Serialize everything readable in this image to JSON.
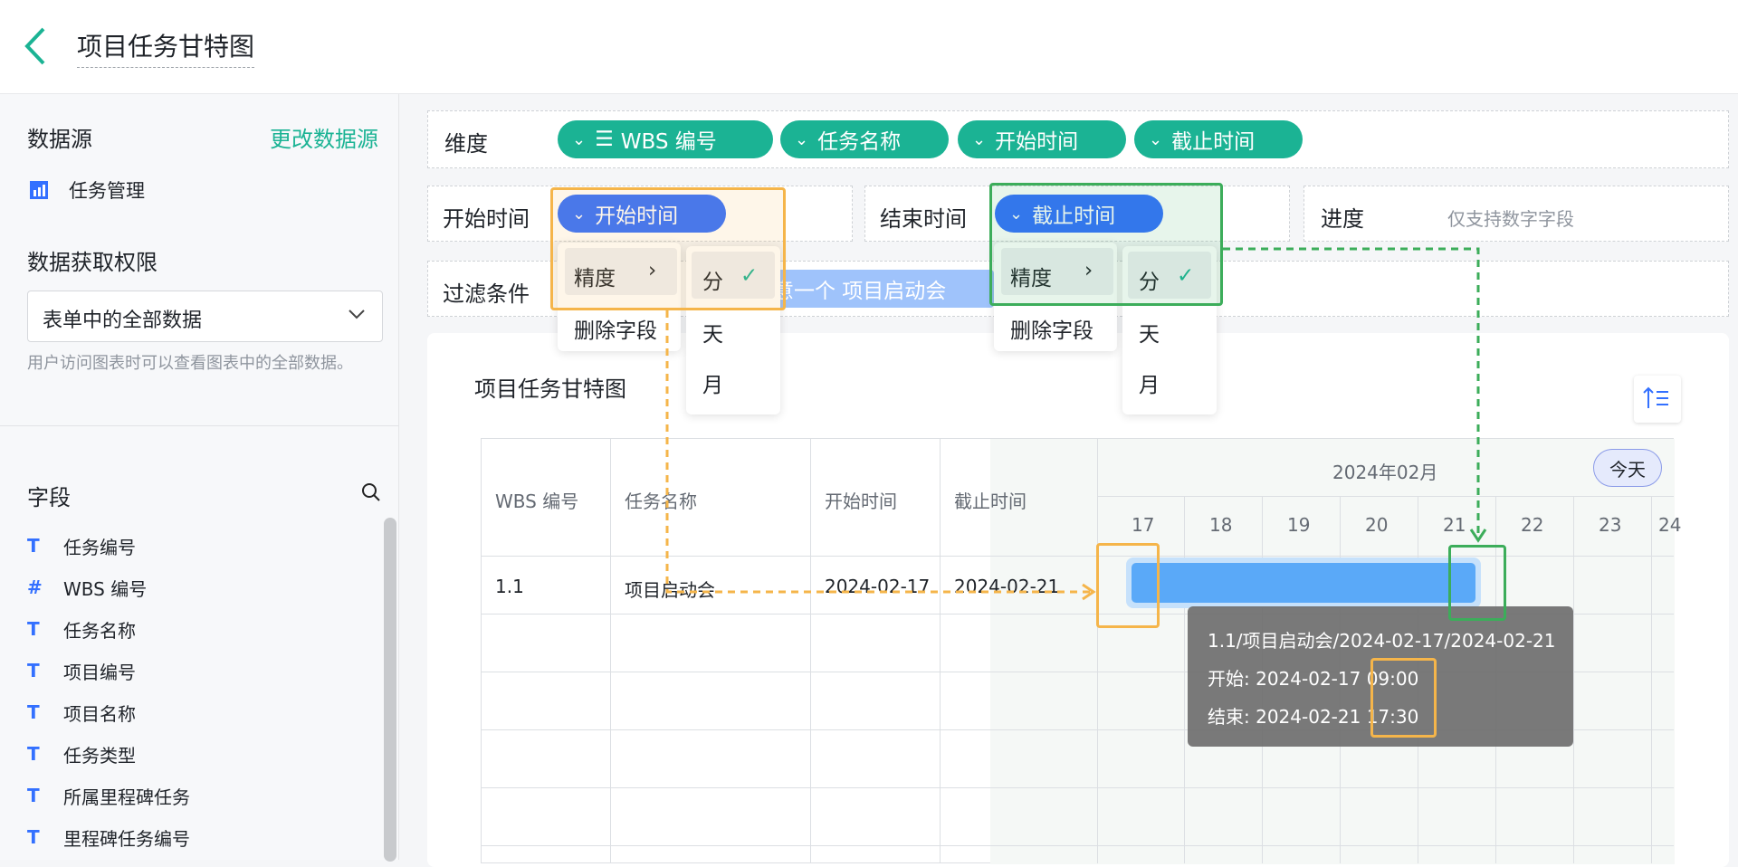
{
  "header": {
    "title": "项目任务甘特图"
  },
  "sidebar": {
    "datasource_label": "数据源",
    "change_link": "更改数据源",
    "datasource_name": "任务管理",
    "permission_label": "数据获取权限",
    "permission_value": "表单中的全部数据",
    "permission_hint": "用户访问图表时可以查看图表中的全部数据。",
    "fields_label": "字段",
    "fields": [
      {
        "type": "T",
        "name": "任务编号"
      },
      {
        "type": "#",
        "name": "WBS 编号"
      },
      {
        "type": "T",
        "name": "任务名称"
      },
      {
        "type": "T",
        "name": "项目编号"
      },
      {
        "type": "T",
        "name": "项目名称"
      },
      {
        "type": "T",
        "name": "任务类型"
      },
      {
        "type": "T",
        "name": "所属里程碑任务"
      },
      {
        "type": "T",
        "name": "里程碑任务编号"
      }
    ]
  },
  "config": {
    "dim_label": "维度",
    "dims": [
      "WBS 编号",
      "任务名称",
      "开始时间",
      "截止时间"
    ],
    "start_label": "开始时间",
    "start_chip": "开始时间",
    "end_label": "结束时间",
    "end_chip": "截止时间",
    "progress_label": "进度",
    "progress_hint": "仅支持数字字段",
    "filter_label": "过滤条件",
    "filter_chip": "意一个 项目启动会"
  },
  "menu": {
    "precision": "精度",
    "delete": "删除字段",
    "opts": [
      "分",
      "天",
      "月"
    ]
  },
  "chart": {
    "title": "项目任务甘特图",
    "columns": [
      "WBS 编号",
      "任务名称",
      "开始时间",
      "截止时间"
    ],
    "month": "2024年02月",
    "today": "今天",
    "days": [
      "17",
      "18",
      "19",
      "20",
      "21",
      "22",
      "23",
      "24"
    ],
    "row": {
      "wbs": "1.1",
      "name": "项目启动会",
      "start": "2024-02-17",
      "end": "2024-02-21"
    },
    "tooltip": {
      "line1": "1.1/项目启动会/2024-02-17/2024-02-21",
      "start_label": "开始:",
      "start_date": "2024-02-17",
      "start_time": "09:00",
      "end_label": "结束:",
      "end_date": "2024-02-21",
      "end_time": "17:30"
    }
  }
}
